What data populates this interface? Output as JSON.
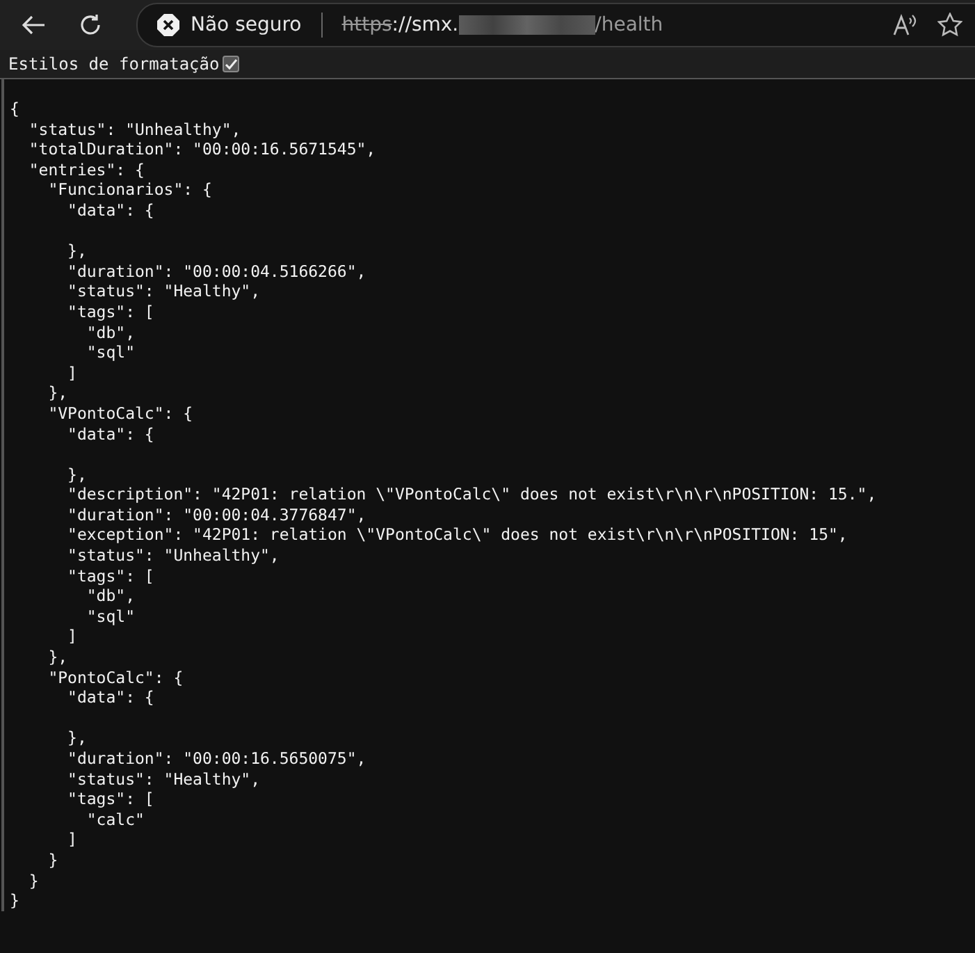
{
  "browser": {
    "security_label": "Não seguro",
    "url_scheme": "https",
    "url_host": "://smx.",
    "url_path": "/health"
  },
  "options": {
    "label": "Estilos de formatação",
    "checked": true
  },
  "json_lines": [
    {
      "text": "{"
    },
    {
      "text": "  \"status\": \"Unhealthy\","
    },
    {
      "text": "  \"totalDuration\": \"00:00:16.5671545\","
    },
    {
      "text": "  \"entries\": {"
    },
    {
      "text": "    \"Funcionarios\": {"
    },
    {
      "text": "      \"data\": {"
    },
    {
      "text": "      },",
      "gap_before": true
    },
    {
      "text": "      \"duration\": \"00:00:04.5166266\","
    },
    {
      "text": "      \"status\": \"Healthy\","
    },
    {
      "text": "      \"tags\": ["
    },
    {
      "text": "        \"db\","
    },
    {
      "text": "        \"sql\""
    },
    {
      "text": "      ]"
    },
    {
      "text": "    },"
    },
    {
      "text": "    \"VPontoCalc\": {"
    },
    {
      "text": "      \"data\": {"
    },
    {
      "text": "      },",
      "gap_before": true
    },
    {
      "text": "      \"description\": \"42P01: relation \\\"VPontoCalc\\\" does not exist\\r\\n\\r\\nPOSITION: 15.\","
    },
    {
      "text": "      \"duration\": \"00:00:04.3776847\","
    },
    {
      "text": "      \"exception\": \"42P01: relation \\\"VPontoCalc\\\" does not exist\\r\\n\\r\\nPOSITION: 15\","
    },
    {
      "text": "      \"status\": \"Unhealthy\","
    },
    {
      "text": "      \"tags\": ["
    },
    {
      "text": "        \"db\","
    },
    {
      "text": "        \"sql\""
    },
    {
      "text": "      ]"
    },
    {
      "text": "    },"
    },
    {
      "text": "    \"PontoCalc\": {"
    },
    {
      "text": "      \"data\": {"
    },
    {
      "text": "      },",
      "gap_before": true
    },
    {
      "text": "      \"duration\": \"00:00:16.5650075\","
    },
    {
      "text": "      \"status\": \"Healthy\","
    },
    {
      "text": "      \"tags\": ["
    },
    {
      "text": "        \"calc\""
    },
    {
      "text": "      ]"
    },
    {
      "text": "    }"
    },
    {
      "text": "  }"
    },
    {
      "text": "}"
    }
  ]
}
